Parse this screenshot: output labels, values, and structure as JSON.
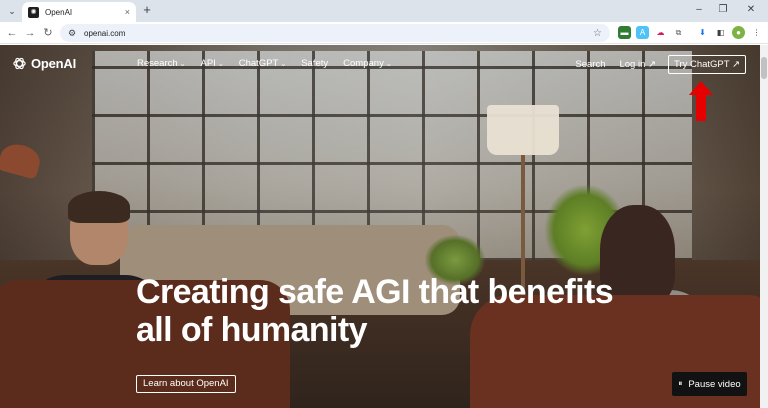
{
  "browser": {
    "tab": {
      "title": "OpenAI",
      "close": "×"
    },
    "new_tab": "+",
    "window": {
      "minimize": "–",
      "maximize": "❐",
      "close": "✕"
    },
    "nav": {
      "back": "←",
      "forward": "→",
      "reload": "↻"
    },
    "url": "openai.com",
    "bookmark_icon": "star-icon"
  },
  "site": {
    "logo_text": "OpenAI",
    "nav": [
      {
        "label": "Research",
        "has_dropdown": true
      },
      {
        "label": "API",
        "has_dropdown": true
      },
      {
        "label": "ChatGPT",
        "has_dropdown": true
      },
      {
        "label": "Safety",
        "has_dropdown": false
      },
      {
        "label": "Company",
        "has_dropdown": true
      }
    ],
    "search_label": "Search",
    "login_label": "Log in ↗",
    "try_label": "Try ChatGPT ↗",
    "headline": "Creating safe AGI that benefits all of humanity",
    "learn_label": "Learn about OpenAI",
    "pause_label": "Pause video",
    "pause_icon": "⏸"
  },
  "colors": {
    "annotation_arrow": "#e60000",
    "tab_bar": "#dde3ea",
    "omnibox": "#edf2fa",
    "pause_button": "#121212"
  }
}
